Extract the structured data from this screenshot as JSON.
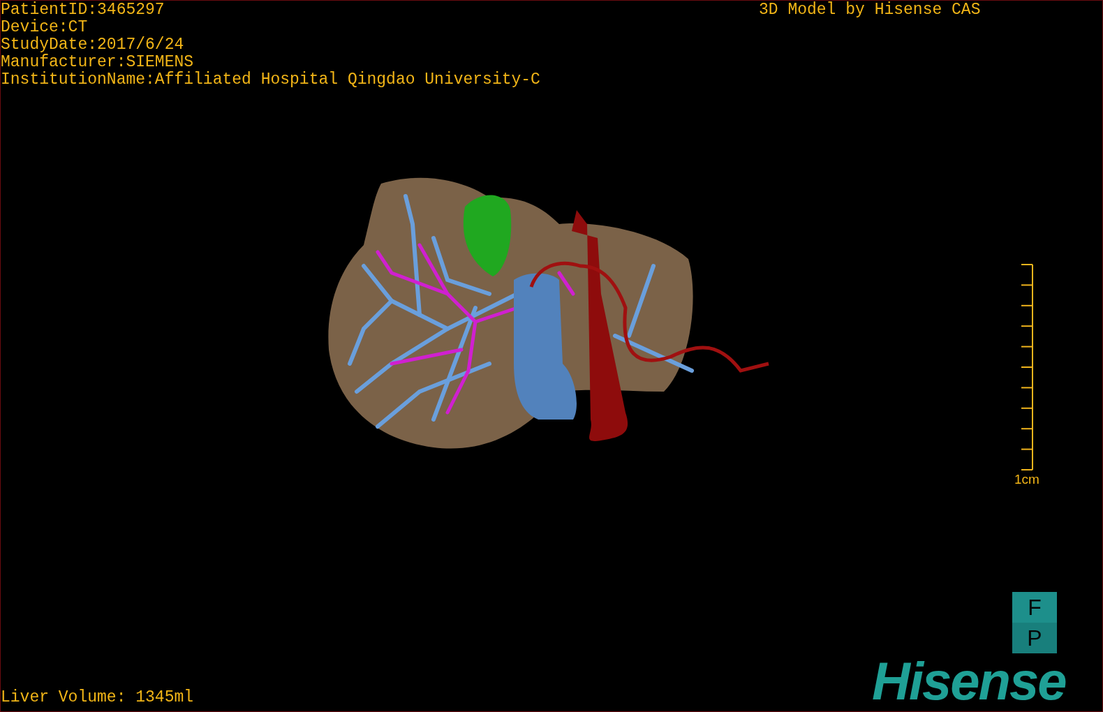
{
  "viewer": {
    "patient_info": [
      "PatientID:3465297",
      "Device:CT",
      "StudyDate:2017/6/24",
      "Manufacturer:SIEMENS",
      "InstitutionName:Affiliated Hospital Qingdao University-C"
    ],
    "title": "3D Model by Hisense CAS",
    "scale_bar": {
      "label": "1cm"
    },
    "orientation": [
      "F",
      "P"
    ],
    "logo": "Hisense",
    "liver_volume": "Liver Volume: 1345ml"
  }
}
